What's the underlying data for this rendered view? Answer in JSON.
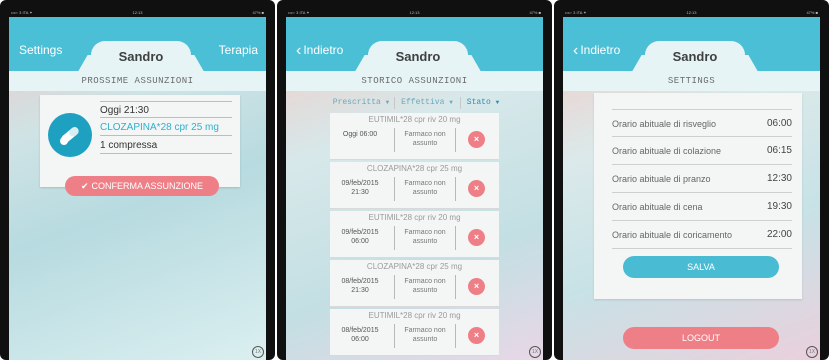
{
  "status": {
    "carrier": "••••◦ 3 ITA ✦",
    "time": "12:13",
    "battery": "47% ■"
  },
  "panel1": {
    "nav_left": "Settings",
    "nav_title": "Sandro",
    "nav_right": "Terapia",
    "section_title": "PROSSIME ASSUNZIONI",
    "card": {
      "when": "Oggi 21:30",
      "drug": "CLOZAPINA*28 cpr 25 mg",
      "dose": "1 compressa"
    },
    "confirm_label": "CONFERMA ASSUNZIONE",
    "home_label": "1X"
  },
  "panel2": {
    "nav_left": "Indietro",
    "nav_title": "Sandro",
    "section_title": "STORICO ASSUNZIONI",
    "columns": [
      "Prescritta",
      "Effettiva",
      "Stato"
    ],
    "entries": [
      {
        "drug": "EUTIMIL*28 cpr riv 20 mg",
        "date": "Oggi 06:00",
        "state": "Farmaco non assunto"
      },
      {
        "drug": "CLOZAPINA*28 cpr 25 mg",
        "date": "09/feb/2015 21:30",
        "state": "Farmaco non assunto"
      },
      {
        "drug": "EUTIMIL*28 cpr riv 20 mg",
        "date": "09/feb/2015 06:00",
        "state": "Farmaco non assunto"
      },
      {
        "drug": "CLOZAPINA*28 cpr 25 mg",
        "date": "08/feb/2015 21:30",
        "state": "Farmaco non assunto"
      },
      {
        "drug": "EUTIMIL*28 cpr riv 20 mg",
        "date": "08/feb/2015 06:00",
        "state": "Farmaco non assunto"
      }
    ],
    "home_label": "1X"
  },
  "panel3": {
    "nav_left": "Indietro",
    "nav_title": "Sandro",
    "section_title": "SETTINGS",
    "rows": [
      {
        "label": "Orario abituale di risveglio",
        "value": "06:00"
      },
      {
        "label": "Orario abituale di colazione",
        "value": "06:15"
      },
      {
        "label": "Orario abituale di pranzo",
        "value": "12:30"
      },
      {
        "label": "Orario abituale di cena",
        "value": "19:30"
      },
      {
        "label": "Orario abituale di coricamento",
        "value": "22:00"
      }
    ],
    "save_label": "SALVA",
    "logout_label": "LOGOUT",
    "home_label": "1X"
  },
  "colors": {
    "accent": "#4bbfd6",
    "danger": "#ef7f86",
    "pill": "#1ea1c0"
  }
}
